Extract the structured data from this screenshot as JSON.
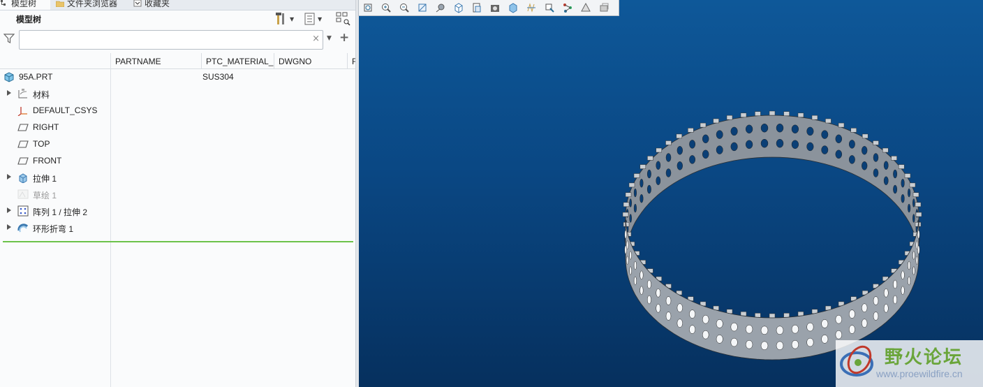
{
  "tabs": [
    {
      "label": "模型树",
      "active": true
    },
    {
      "label": "文件夹浏览器",
      "active": false
    },
    {
      "label": "收藏夹",
      "active": false
    }
  ],
  "panel": {
    "title": "模型树"
  },
  "search": {
    "value": "",
    "placeholder": "",
    "clear": "×"
  },
  "columns": [
    "PARTNAME",
    "PTC_MATERIAL_",
    "DWGNO",
    "F"
  ],
  "tree": [
    {
      "label": "95A.PRT",
      "icon": "part-icon",
      "expandable": false,
      "indent": 0,
      "material": "SUS304"
    },
    {
      "label": "材料",
      "icon": "material-icon",
      "expandable": true,
      "indent": 1,
      "material": ""
    },
    {
      "label": "DEFAULT_CSYS",
      "icon": "csys-icon",
      "expandable": false,
      "indent": 1,
      "material": ""
    },
    {
      "label": "RIGHT",
      "icon": "datum-plane-icon",
      "expandable": false,
      "indent": 1,
      "material": ""
    },
    {
      "label": "TOP",
      "icon": "datum-plane-icon",
      "expandable": false,
      "indent": 1,
      "material": ""
    },
    {
      "label": "FRONT",
      "icon": "datum-plane-icon",
      "expandable": false,
      "indent": 1,
      "material": ""
    },
    {
      "label": "拉伸 1",
      "icon": "extrude-icon",
      "expandable": true,
      "indent": 1,
      "material": ""
    },
    {
      "label": "草绘 1",
      "icon": "sketch-icon",
      "expandable": false,
      "indent": 1,
      "material": "",
      "dimmed": true
    },
    {
      "label": "阵列 1 / 拉伸 2",
      "icon": "pattern-icon",
      "expandable": true,
      "indent": 1,
      "material": ""
    },
    {
      "label": "环形折弯 1",
      "icon": "toroidal-bend-icon",
      "expandable": true,
      "indent": 1,
      "material": ""
    }
  ],
  "view_toolbar": [
    "refit-icon",
    "zoom-in-icon",
    "zoom-out-icon",
    "repaint-icon",
    "display-style-icon",
    "saved-views-icon",
    "view-manager-icon",
    "perspective-icon",
    "spin-center-icon",
    "datum-display-icon",
    "annotation-icon",
    "section-icon",
    "named-view-icon",
    "hide-icon"
  ],
  "watermark": {
    "title": "野火论坛",
    "url": "www.proewildfire.cn"
  },
  "colors": {
    "insert_line": "#6cc24a",
    "viewport_top": "#0e5899",
    "viewport_bottom": "#06305e",
    "model_face": "#8b939c"
  }
}
